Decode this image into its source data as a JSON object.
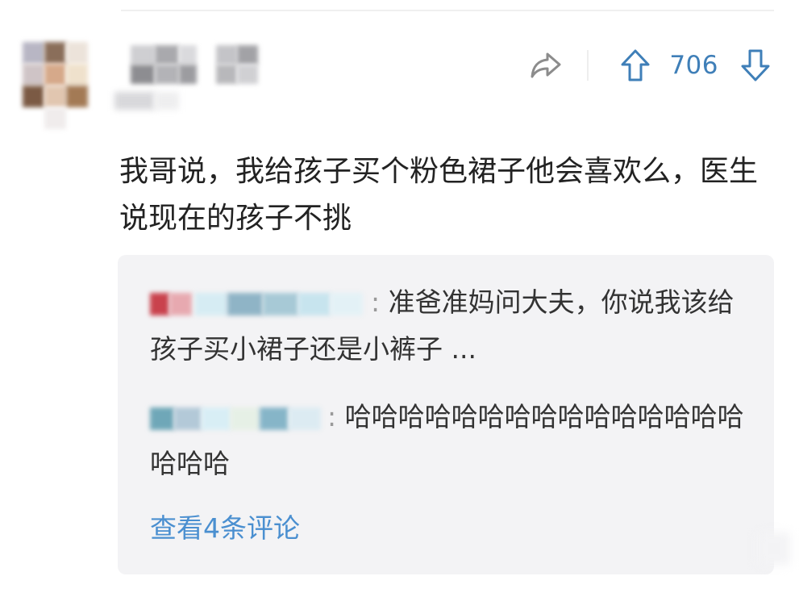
{
  "post": {
    "comment_text": "我哥说，我给孩子买个粉色裙子他会喜欢么，医生说现在的孩子不挑"
  },
  "actions": {
    "share_icon": "share-arrow-icon",
    "upvote_icon": "arrow-up-icon",
    "downvote_icon": "arrow-down-icon",
    "vote_count": "706"
  },
  "replies": [
    {
      "separator": ": ",
      "text": "准爸准妈问大夫，你说我该给孩子买小裙子还是小裤子 ..."
    },
    {
      "separator": ": ",
      "text": "哈哈哈哈哈哈哈哈哈哈哈哈哈哈哈哈哈哈"
    }
  ],
  "view_more_label": "查看4条评论",
  "colors": {
    "accent": "#3f7fb8",
    "link": "#4a8fd0",
    "reply_background": "#f3f3f5",
    "text": "#222222"
  }
}
